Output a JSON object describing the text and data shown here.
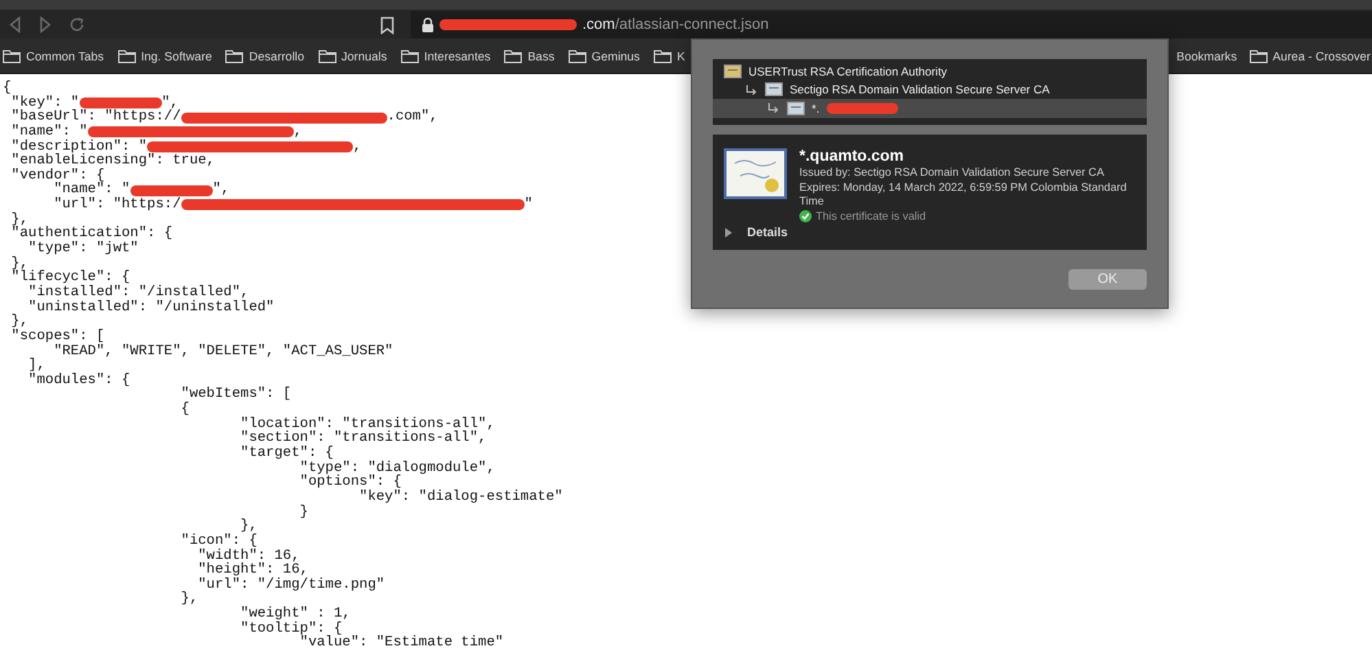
{
  "toolbar": {
    "url_host_tail": ".com",
    "url_path": "/atlassian-connect.json"
  },
  "bookmarks": [
    {
      "label": "Common Tabs"
    },
    {
      "label": "Ing. Software"
    },
    {
      "label": "Desarrollo"
    },
    {
      "label": "Jornuals"
    },
    {
      "label": "Interesantes"
    },
    {
      "label": "Bass"
    },
    {
      "label": "Geminus"
    },
    {
      "label": "K"
    }
  ],
  "bookmarks_right": [
    {
      "label": "Bookmarks",
      "kind": "text"
    },
    {
      "label": "Aurea - Crossover",
      "kind": "folder"
    }
  ],
  "code_lines": [
    [
      {
        "kind": "text",
        "text": "{"
      }
    ],
    [
      {
        "kind": "text",
        "text": " \"key\": \""
      },
      {
        "kind": "redaction"
      },
      {
        "kind": "text",
        "text": "\","
      }
    ],
    [
      {
        "kind": "text",
        "text": " \"baseUrl\": \"https://"
      },
      {
        "kind": "redaction-long"
      },
      {
        "kind": "text",
        "text": ".com\","
      }
    ],
    [
      {
        "kind": "text",
        "text": " \"name\": \""
      },
      {
        "kind": "redaction-long"
      },
      {
        "kind": "text",
        "text": ","
      }
    ],
    [
      {
        "kind": "text",
        "text": " \"description\": \""
      },
      {
        "kind": "redaction-long"
      },
      {
        "kind": "text",
        "text": ","
      }
    ],
    [
      {
        "kind": "text",
        "text": " \"enableLicensing\": true,"
      }
    ],
    [
      {
        "kind": "text",
        "text": " \"vendor\": {"
      }
    ],
    [
      {
        "kind": "text",
        "text": "      \"name\": \""
      },
      {
        "kind": "redaction"
      },
      {
        "kind": "text",
        "text": "\","
      }
    ],
    [
      {
        "kind": "text",
        "text": "      \"url\": \"https:/"
      },
      {
        "kind": "redaction-xlong"
      },
      {
        "kind": "text",
        "text": "\""
      }
    ],
    [
      {
        "kind": "text",
        "text": " },"
      }
    ],
    [
      {
        "kind": "text",
        "text": " \"authentication\": {"
      }
    ],
    [
      {
        "kind": "text",
        "text": "   \"type\": \"jwt\""
      }
    ],
    [
      {
        "kind": "text",
        "text": " },"
      }
    ],
    [
      {
        "kind": "text",
        "text": " \"lifecycle\": {"
      }
    ],
    [
      {
        "kind": "text",
        "text": "   \"installed\": \"/installed\","
      }
    ],
    [
      {
        "kind": "text",
        "text": "   \"uninstalled\": \"/uninstalled\""
      }
    ],
    [
      {
        "kind": "text",
        "text": " },"
      }
    ],
    [
      {
        "kind": "text",
        "text": " \"scopes\": ["
      }
    ],
    [
      {
        "kind": "text",
        "text": "      \"READ\", \"WRITE\", \"DELETE\", \"ACT_AS_USER\""
      }
    ],
    [
      {
        "kind": "text",
        "text": "   ],"
      }
    ],
    [
      {
        "kind": "text",
        "text": "   \"modules\": {"
      }
    ],
    [
      {
        "kind": "text",
        "text": "                     \"webItems\": ["
      }
    ],
    [
      {
        "kind": "text",
        "text": "                     {"
      }
    ],
    [
      {
        "kind": "text",
        "text": "                            \"location\": \"transitions-all\","
      }
    ],
    [
      {
        "kind": "text",
        "text": "                            \"section\": \"transitions-all\","
      }
    ],
    [
      {
        "kind": "text",
        "text": "                            \"target\": {"
      }
    ],
    [
      {
        "kind": "text",
        "text": "                                   \"type\": \"dialogmodule\","
      }
    ],
    [
      {
        "kind": "text",
        "text": "                                   \"options\": {"
      }
    ],
    [
      {
        "kind": "text",
        "text": "                                          \"key\": \"dialog-estimate\""
      }
    ],
    [
      {
        "kind": "text",
        "text": "                                   }"
      }
    ],
    [
      {
        "kind": "text",
        "text": "                            },"
      }
    ],
    [
      {
        "kind": "text",
        "text": "                     \"icon\": {"
      }
    ],
    [
      {
        "kind": "text",
        "text": "                       \"width\": 16,"
      }
    ],
    [
      {
        "kind": "text",
        "text": "                       \"height\": 16,"
      }
    ],
    [
      {
        "kind": "text",
        "text": "                       \"url\": \"/img/time.png\""
      }
    ],
    [
      {
        "kind": "text",
        "text": "                     },"
      }
    ],
    [
      {
        "kind": "text",
        "text": "                            \"weight\" : 1,"
      }
    ],
    [
      {
        "kind": "text",
        "text": "                            \"tooltip\": {"
      }
    ],
    [
      {
        "kind": "text",
        "text": "                                   \"value\": \"Estimate time\""
      }
    ]
  ],
  "certificate_dialog": {
    "chain": [
      {
        "name": "USERTrust RSA Certification Authority",
        "selected": false,
        "redacted": false,
        "children": [
          {
            "name": "Sectigo RSA Domain Validation Secure Server CA",
            "selected": false,
            "redacted": false,
            "children": [
              {
                "name": "*.",
                "selected": true,
                "redacted": true
              }
            ]
          }
        ]
      }
    ],
    "title": "*.quamto.com",
    "issued_by": "Issued by: Sectigo RSA Domain Validation Secure Server CA",
    "expires": "Expires: Monday, 14 March 2022, 6:59:59 PM Colombia Standard Time",
    "valid": true,
    "valid_text": "This certificate is valid",
    "details": {
      "label": "Details",
      "expanded": false
    },
    "button": "OK"
  }
}
